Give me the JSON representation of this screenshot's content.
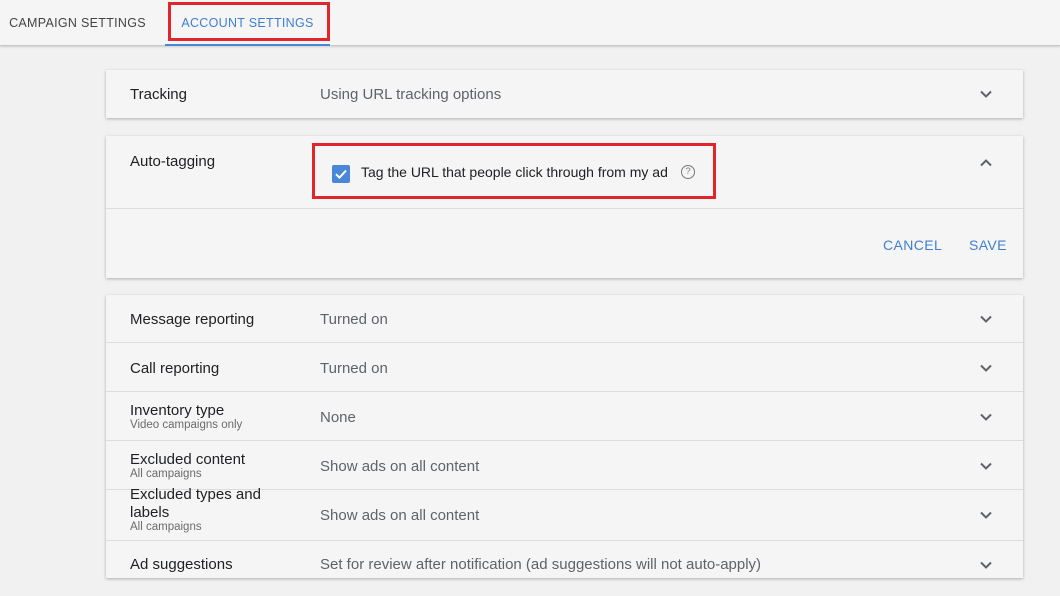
{
  "tabs": {
    "campaign_settings": "CAMPAIGN SETTINGS",
    "account_settings": "ACCOUNT SETTINGS",
    "active": "account_settings"
  },
  "tracking": {
    "label": "Tracking",
    "value": "Using URL tracking options"
  },
  "auto_tagging": {
    "label": "Auto-tagging",
    "checkbox_label": "Tag the URL that people click through from my ad",
    "checked": true,
    "help_glyph": "?",
    "cancel_label": "CANCEL",
    "save_label": "SAVE"
  },
  "settings": [
    {
      "label": "Message reporting",
      "sublabel": "",
      "value": "Turned on"
    },
    {
      "label": "Call reporting",
      "sublabel": "",
      "value": "Turned on"
    },
    {
      "label": "Inventory type",
      "sublabel": "Video campaigns only",
      "value": "None"
    },
    {
      "label": "Excluded content",
      "sublabel": "All campaigns",
      "value": "Show ads on all content"
    },
    {
      "label": "Excluded types and labels",
      "sublabel": "All campaigns",
      "value": "Show ads on all content"
    },
    {
      "label": "Ad suggestions",
      "sublabel": "",
      "value": "Set for review after notification (ad suggestions will not auto-apply)"
    }
  ],
  "icons": {
    "expand": "chevron-down-icon",
    "collapse": "chevron-up-icon",
    "help": "help-circle-icon",
    "check": "check-icon"
  },
  "colors": {
    "accent": "#4a87d6",
    "highlight": "#e0262b",
    "background": "#f1f1f1"
  }
}
